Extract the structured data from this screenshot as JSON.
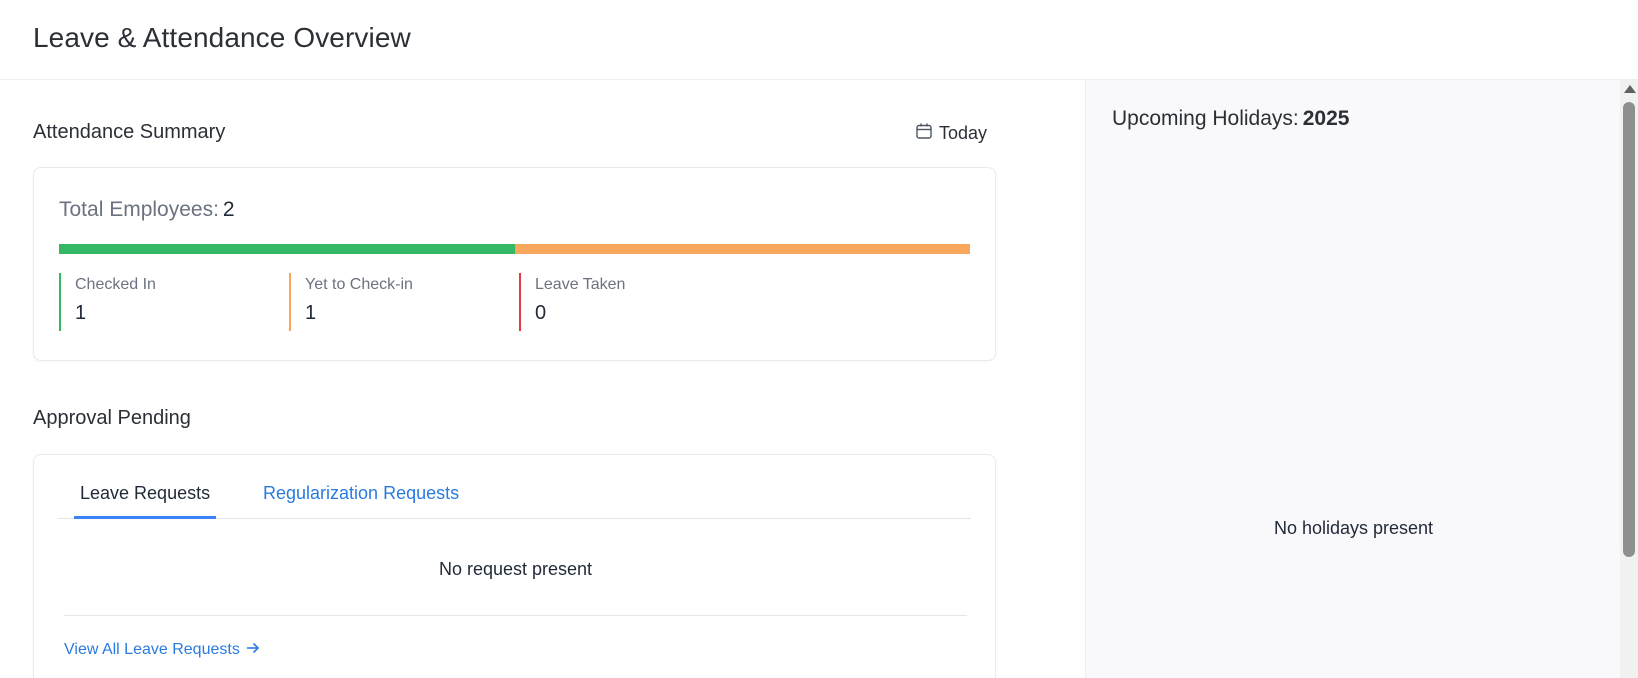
{
  "header": {
    "title": "Leave & Attendance Overview"
  },
  "attendance_summary": {
    "title": "Attendance Summary",
    "filter_label": "Today",
    "filter_icon": "calendar-icon",
    "total_label": "Total Employees:",
    "total_value": "2",
    "progress": {
      "checked_in_fraction": 0.5,
      "yet_to_check_in_fraction": 0.5,
      "colors": {
        "checked_in": "#34b866",
        "yet_to_check_in": "#f7a65b",
        "leave_taken": "#e23b4a"
      }
    },
    "stats": [
      {
        "label": "Checked In",
        "value": "1"
      },
      {
        "label": "Yet to Check-in",
        "value": "1"
      },
      {
        "label": "Leave Taken",
        "value": "0"
      }
    ]
  },
  "approval": {
    "title": "Approval Pending",
    "tabs": [
      {
        "label": "Leave Requests",
        "active": true
      },
      {
        "label": "Regularization Requests",
        "active": false
      }
    ],
    "empty_text": "No request present",
    "view_all_label": "View All Leave Requests",
    "view_all_icon": "arrow-right-icon"
  },
  "holidays": {
    "title": "Upcoming Holidays:",
    "year": "2025",
    "empty_text": "No holidays present"
  },
  "colors": {
    "accent": "#2a7be0",
    "tab_underline": "#3b82f6"
  }
}
